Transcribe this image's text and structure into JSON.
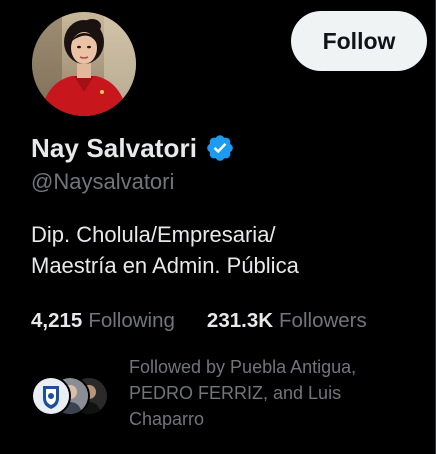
{
  "profile": {
    "display_name": "Nay Salvatori",
    "handle": "@Naysalvatori",
    "verified": true,
    "bio": "Dip. Cholula/Empresaria/\nMaestría en Admin. Pública",
    "avatar_icon": "profile-photo"
  },
  "actions": {
    "follow_label": "Follow"
  },
  "stats": {
    "following_count": "4,215",
    "following_label": "Following",
    "followers_count": "231.3K",
    "followers_label": "Followers"
  },
  "followed_by": {
    "text": "Followed by Puebla Antigua, PEDRO FERRIZ, and Luis Chaparro",
    "avatars": [
      "puebla-antigua-avatar",
      "pedro-ferriz-avatar",
      "luis-chaparro-avatar"
    ]
  },
  "colors": {
    "background": "#000000",
    "text_primary": "#e7e9ea",
    "text_secondary": "#71767b",
    "verified_blue": "#1d9bf0",
    "button_bg": "#eff3f4",
    "button_text": "#0f1419"
  }
}
